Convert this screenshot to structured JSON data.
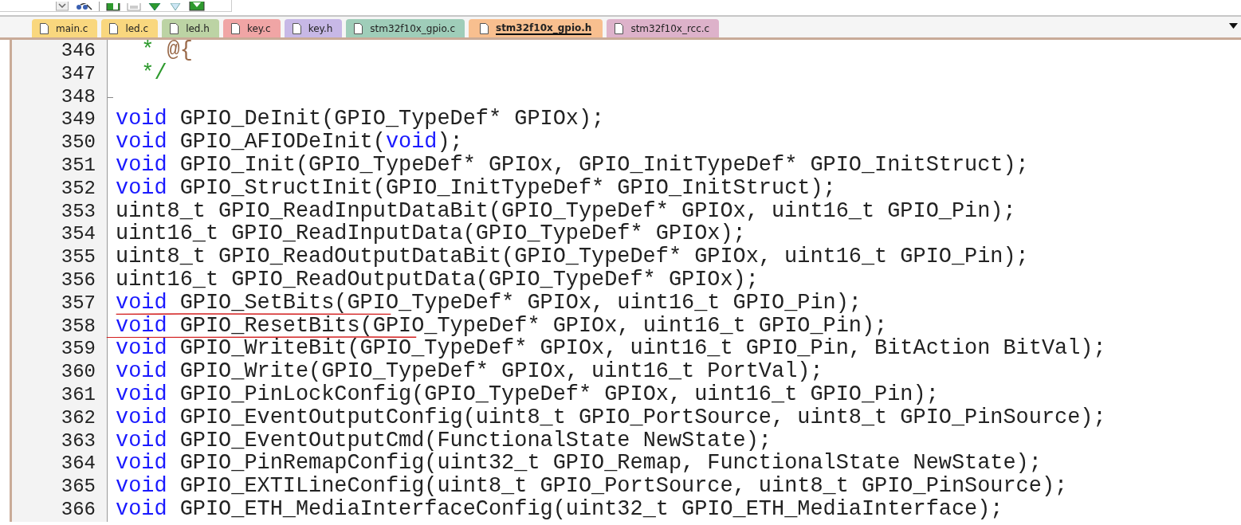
{
  "tabs": [
    {
      "label": "main.c",
      "color": "#f9d77e",
      "selected": false
    },
    {
      "label": "led.c",
      "color": "#f9d77e",
      "selected": false
    },
    {
      "label": "led.h",
      "color": "#bcd3a4",
      "selected": false
    },
    {
      "label": "key.c",
      "color": "#f0a5a5",
      "selected": false
    },
    {
      "label": "key.h",
      "color": "#c7b8e6",
      "selected": false
    },
    {
      "label": "stm32f10x_gpio.c",
      "color": "#9fcdb9",
      "selected": false
    },
    {
      "label": "stm32f10x_gpio.h",
      "color": "#f8bf8f",
      "selected": true
    },
    {
      "label": "stm32f10x_rcc.c",
      "color": "#ddb2ca",
      "selected": false
    }
  ],
  "editor": {
    "lines": [
      {
        "number": "346",
        "tokens": [
          {
            "kind": "comment",
            "text": "  *"
          },
          {
            "kind": "tag",
            "text": " @{"
          }
        ]
      },
      {
        "number": "347",
        "tokens": [
          {
            "kind": "comment",
            "text": "  */"
          }
        ]
      },
      {
        "number": "348"
      },
      {
        "number": "349",
        "tokens": [
          {
            "kind": "keyword",
            "text": "void"
          },
          {
            "kind": "plain",
            "text": " GPIO_DeInit(GPIO_TypeDef* GPIOx);"
          }
        ]
      },
      {
        "number": "350",
        "tokens": [
          {
            "kind": "keyword",
            "text": "void"
          },
          {
            "kind": "plain",
            "text": " GPIO_AFIODeInit("
          },
          {
            "kind": "keyword",
            "text": "void"
          },
          {
            "kind": "plain",
            "text": ");"
          }
        ]
      },
      {
        "number": "351",
        "tokens": [
          {
            "kind": "keyword",
            "text": "void"
          },
          {
            "kind": "plain",
            "text": " GPIO_Init(GPIO_TypeDef* GPIOx, GPIO_InitTypeDef* GPIO_InitStruct);"
          }
        ]
      },
      {
        "number": "352",
        "tokens": [
          {
            "kind": "keyword",
            "text": "void"
          },
          {
            "kind": "plain",
            "text": " GPIO_StructInit(GPIO_InitTypeDef* GPIO_InitStruct);"
          }
        ]
      },
      {
        "number": "353",
        "tokens": [
          {
            "kind": "plain",
            "text": "uint8_t GPIO_ReadInputDataBit(GPIO_TypeDef* GPIOx, uint16_t GPIO_Pin);"
          }
        ]
      },
      {
        "number": "354",
        "tokens": [
          {
            "kind": "plain",
            "text": "uint16_t GPIO_ReadInputData(GPIO_TypeDef* GPIOx);"
          }
        ]
      },
      {
        "number": "355",
        "tokens": [
          {
            "kind": "plain",
            "text": "uint8_t GPIO_ReadOutputDataBit(GPIO_TypeDef* GPIOx, uint16_t GPIO_Pin);"
          }
        ]
      },
      {
        "number": "356",
        "tokens": [
          {
            "kind": "plain",
            "text": "uint16_t GPIO_ReadOutputData(GPIO_TypeDef* GPIOx);"
          }
        ]
      },
      {
        "number": "357",
        "tokens": [
          {
            "kind": "keyword",
            "text": "void"
          },
          {
            "kind": "plain",
            "text": " GPIO_SetBits(GPIO_TypeDef* GPIOx, uint16_t GPIO_Pin);"
          }
        ]
      },
      {
        "number": "358",
        "tokens": [
          {
            "kind": "keyword",
            "text": "void"
          },
          {
            "kind": "plain",
            "text": " GPIO_ResetBits(GPIO_TypeDef* GPIOx, uint16_t GPIO_Pin);"
          }
        ]
      },
      {
        "number": "359",
        "tokens": [
          {
            "kind": "keyword",
            "text": "void"
          },
          {
            "kind": "plain",
            "text": " GPIO_WriteBit(GPIO_TypeDef* GPIOx, uint16_t GPIO_Pin, BitAction BitVal);"
          }
        ]
      },
      {
        "number": "360",
        "tokens": [
          {
            "kind": "keyword",
            "text": "void"
          },
          {
            "kind": "plain",
            "text": " GPIO_Write(GPIO_TypeDef* GPIOx, uint16_t PortVal);"
          }
        ]
      },
      {
        "number": "361",
        "tokens": [
          {
            "kind": "keyword",
            "text": "void"
          },
          {
            "kind": "plain",
            "text": " GPIO_PinLockConfig(GPIO_TypeDef* GPIOx, uint16_t GPIO_Pin);"
          }
        ]
      },
      {
        "number": "362",
        "tokens": [
          {
            "kind": "keyword",
            "text": "void"
          },
          {
            "kind": "plain",
            "text": " GPIO_EventOutputConfig(uint8_t GPIO_PortSource, uint8_t GPIO_PinSource);"
          }
        ]
      },
      {
        "number": "363",
        "tokens": [
          {
            "kind": "keyword",
            "text": "void"
          },
          {
            "kind": "plain",
            "text": " GPIO_EventOutputCmd(FunctionalState NewState);"
          }
        ]
      },
      {
        "number": "364",
        "tokens": [
          {
            "kind": "keyword",
            "text": "void"
          },
          {
            "kind": "plain",
            "text": " GPIO_PinRemapConfig(uint32_t GPIO_Remap, FunctionalState NewState);"
          }
        ]
      },
      {
        "number": "365",
        "tokens": [
          {
            "kind": "keyword",
            "text": "void"
          },
          {
            "kind": "plain",
            "text": " GPIO_EXTILineConfig(uint8_t GPIO_PortSource, uint8_t GPIO_PinSource);"
          }
        ]
      },
      {
        "number": "366",
        "tokens": [
          {
            "kind": "keyword",
            "text": "void"
          },
          {
            "kind": "plain",
            "text": " GPIO_ETH_MediaInterfaceConfig(uint32_t GPIO_ETH_MediaInterface);"
          }
        ]
      }
    ]
  }
}
